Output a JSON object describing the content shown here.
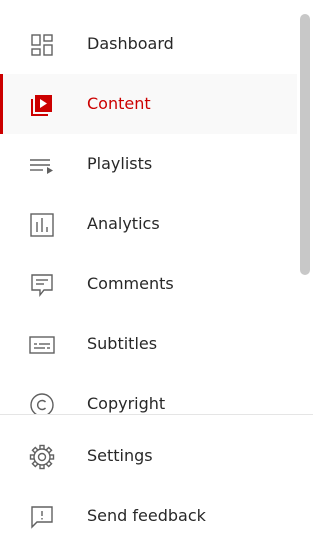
{
  "sidebar": {
    "items": [
      {
        "label": "Dashboard",
        "icon": "dashboard-icon",
        "active": false
      },
      {
        "label": "Content",
        "icon": "content-icon",
        "active": true
      },
      {
        "label": "Playlists",
        "icon": "playlists-icon",
        "active": false
      },
      {
        "label": "Analytics",
        "icon": "analytics-icon",
        "active": false
      },
      {
        "label": "Comments",
        "icon": "comments-icon",
        "active": false
      },
      {
        "label": "Subtitles",
        "icon": "subtitles-icon",
        "active": false
      },
      {
        "label": "Copyright",
        "icon": "copyright-icon",
        "active": false
      }
    ],
    "bottom_items": [
      {
        "label": "Settings",
        "icon": "gear-icon"
      },
      {
        "label": "Send feedback",
        "icon": "feedback-icon"
      }
    ]
  },
  "colors": {
    "accent": "#cc0000",
    "text": "#282828",
    "icon": "#606060",
    "active_bg": "#f9f9f9",
    "divider": "#e5e5e5",
    "scroll_thumb": "#c8c8c8"
  }
}
